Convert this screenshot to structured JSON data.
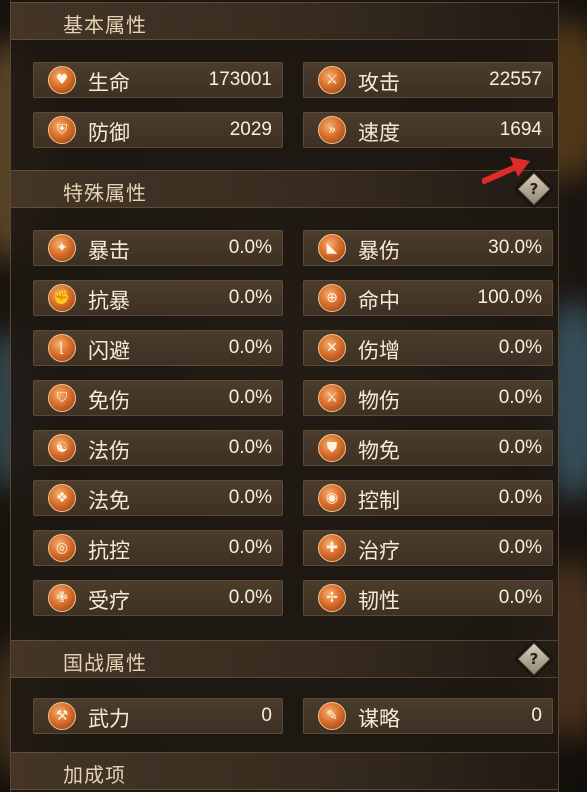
{
  "sections": {
    "basic": {
      "title": "基本属性"
    },
    "special": {
      "title": "特殊属性"
    },
    "national": {
      "title": "国战属性"
    },
    "bonus": {
      "title": "加成项"
    }
  },
  "help_label": "?",
  "basic_stats": [
    {
      "label": "生命",
      "value": "173001",
      "icon": "heart-icon"
    },
    {
      "label": "攻击",
      "value": "22557",
      "icon": "crossed-swords-icon"
    },
    {
      "label": "防御",
      "value": "2029",
      "icon": "shield-icon"
    },
    {
      "label": "速度",
      "value": "1694",
      "icon": "speed-icon"
    }
  ],
  "special_stats": [
    {
      "label": "暴击",
      "value": "0.0%",
      "icon": "critical-strike-icon"
    },
    {
      "label": "暴伤",
      "value": "30.0%",
      "icon": "critical-damage-icon"
    },
    {
      "label": "抗暴",
      "value": "0.0%",
      "icon": "flexed-arm-icon"
    },
    {
      "label": "命中",
      "value": "100.0%",
      "icon": "crosshair-icon"
    },
    {
      "label": "闪避",
      "value": "0.0%",
      "icon": "boot-icon"
    },
    {
      "label": "伤增",
      "value": "0.0%",
      "icon": "damage-boost-icon"
    },
    {
      "label": "免伤",
      "value": "0.0%",
      "icon": "damage-reduction-icon"
    },
    {
      "label": "物伤",
      "value": "0.0%",
      "icon": "physical-damage-icon"
    },
    {
      "label": "法伤",
      "value": "0.0%",
      "icon": "yin-yang-icon"
    },
    {
      "label": "物免",
      "value": "0.0%",
      "icon": "physical-resist-icon"
    },
    {
      "label": "法免",
      "value": "0.0%",
      "icon": "magic-resist-icon"
    },
    {
      "label": "控制",
      "value": "0.0%",
      "icon": "control-icon"
    },
    {
      "label": "抗控",
      "value": "0.0%",
      "icon": "target-icon"
    },
    {
      "label": "治疗",
      "value": "0.0%",
      "icon": "healing-icon"
    },
    {
      "label": "受疗",
      "value": "0.0%",
      "icon": "received-healing-icon"
    },
    {
      "label": "韧性",
      "value": "0.0%",
      "icon": "tenacity-icon"
    }
  ],
  "national_stats": [
    {
      "label": "武力",
      "value": "0",
      "icon": "force-icon"
    },
    {
      "label": "谋略",
      "value": "0",
      "icon": "scroll-icon"
    }
  ],
  "colors": {
    "accent_orange": "#d96f2b",
    "arrow_red": "#e02a2a",
    "text_light": "#f5ead6"
  }
}
